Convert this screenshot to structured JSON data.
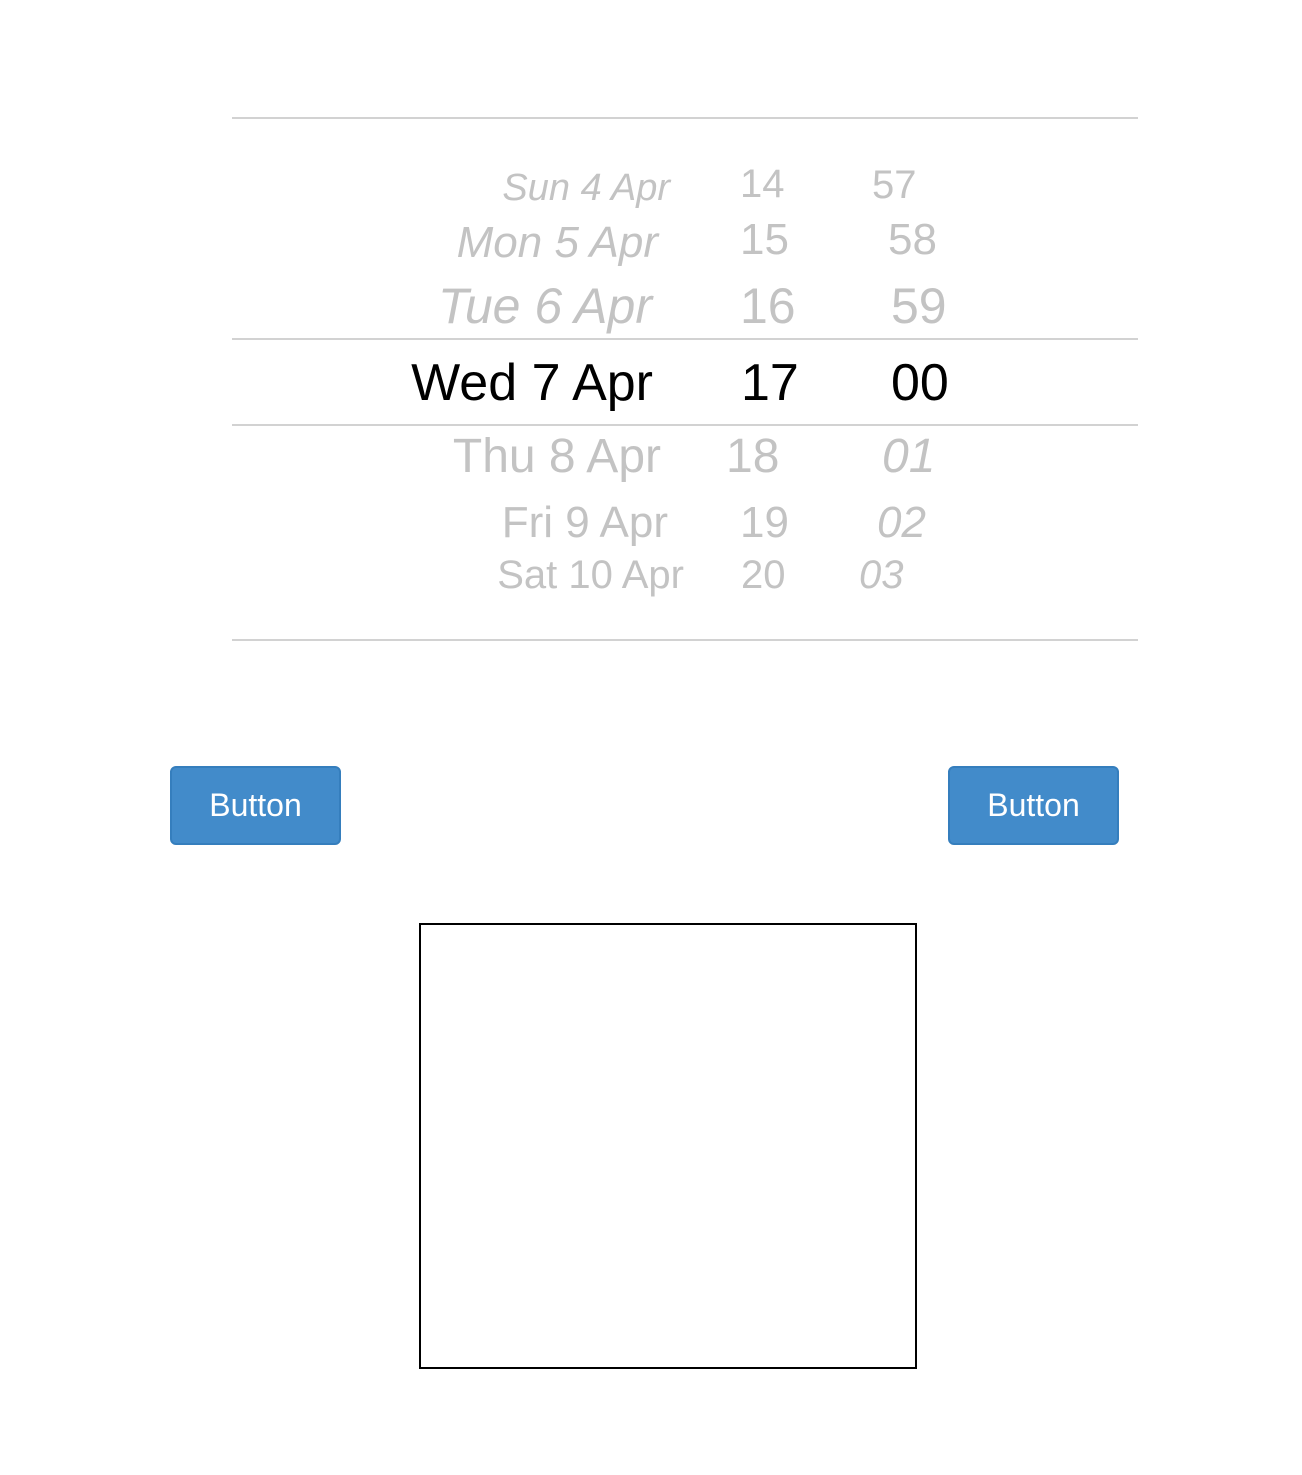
{
  "picker": {
    "days": [
      "Sun 4 Apr",
      "Mon 5 Apr",
      "Tue 6 Apr",
      "Wed 7 Apr",
      "Thu 8 Apr",
      "Fri 9 Apr",
      "Sat 10 Apr"
    ],
    "hours": [
      "14",
      "15",
      "16",
      "17",
      "18",
      "19",
      "20"
    ],
    "minutes": [
      "57",
      "58",
      "59",
      "00",
      "01",
      "02",
      "03"
    ],
    "selected": {
      "day": "Wed 7 Apr",
      "hour": "17",
      "minute": "00"
    },
    "colors": {
      "selected_text": "#000000",
      "unselected_text": "#c3c3c3",
      "separator": "#d2d2d2"
    }
  },
  "buttons": {
    "left_label": "Button",
    "right_label": "Button",
    "color": "#428bca"
  }
}
